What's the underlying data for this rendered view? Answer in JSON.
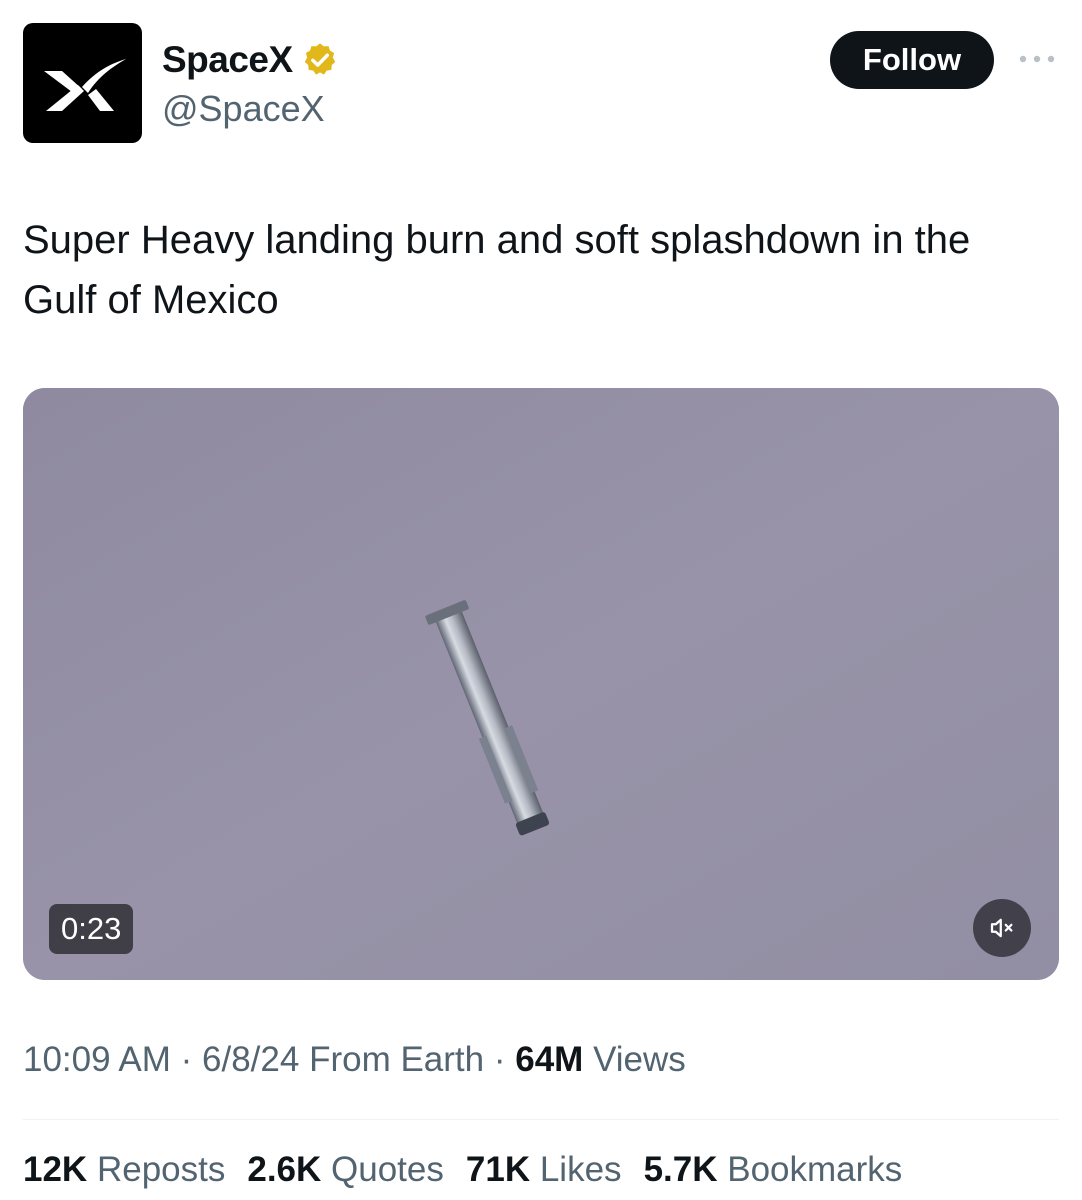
{
  "author": {
    "display_name": "SpaceX",
    "handle": "@SpaceX",
    "avatar_icon": "spacex-x-logo-icon",
    "verified_icon": "verified-badge-icon",
    "verified_color": "#e2b719"
  },
  "header": {
    "follow_label": "Follow",
    "more_icon": "more-options-icon"
  },
  "tweet": {
    "text": "Super Heavy landing burn and soft splashdown in the Gulf of Mexico"
  },
  "media": {
    "type": "video",
    "duration": "0:23",
    "mute_icon": "speaker-muted-icon"
  },
  "meta": {
    "time": "10:09 AM",
    "date": "6/8/24",
    "source": "From Earth",
    "separator": "·",
    "views_count": "64M",
    "views_label": "Views"
  },
  "stats": [
    {
      "count": "12K",
      "label": "Reposts"
    },
    {
      "count": "2.6K",
      "label": "Quotes"
    },
    {
      "count": "71K",
      "label": "Likes"
    },
    {
      "count": "5.7K",
      "label": "Bookmarks"
    }
  ],
  "colors": {
    "text_primary": "#0f1419",
    "text_secondary": "#536471",
    "follow_bg": "#0f1419",
    "sky": "#938fa3"
  }
}
